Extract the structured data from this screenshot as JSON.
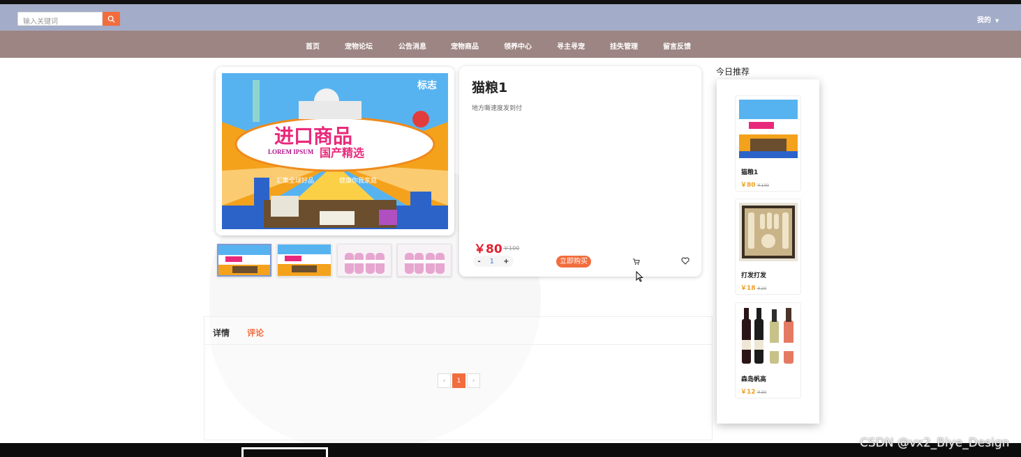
{
  "header": {
    "search_placeholder": "输入关键词",
    "user_menu": "我的"
  },
  "nav": [
    "首页",
    "宠物论坛",
    "公告消息",
    "宠物商品",
    "领养中心",
    "寻主寻宠",
    "挂失管理",
    "留言反馈"
  ],
  "product": {
    "banner_tag": "标志",
    "banner_title": "进口商品",
    "banner_sub": "国产精选",
    "banner_lorem": "LOREM IPSUM",
    "banner_slogan_left": "汇集全球好品",
    "banner_slogan_right": "健康你我家庭",
    "title": "猫粮1",
    "description": "地方嘶速度发到付",
    "price": "￥80",
    "old_price": "￥100",
    "quantity_minus": "-",
    "quantity": "1",
    "quantity_plus": "+",
    "buy_label": "立即购买"
  },
  "tabs": [
    "详情",
    "评论"
  ],
  "pagination": {
    "prev": "‹",
    "current": "1",
    "next": "›"
  },
  "recommend": {
    "title": "今日推荐",
    "items": [
      {
        "name": "猫粮1",
        "price": "￥80",
        "old": "￥100"
      },
      {
        "name": "打发打发",
        "price": "￥18",
        "old": "￥20"
      },
      {
        "name": "森岛帆高",
        "price": "￥12",
        "old": "￥30"
      }
    ]
  },
  "watermark": "CSDN @vx2_Biye_Design",
  "colors": {
    "accent": "#f26d3d",
    "topbar": "#a3acc8",
    "navbar": "#9c8582",
    "price": "#e01f2e"
  }
}
